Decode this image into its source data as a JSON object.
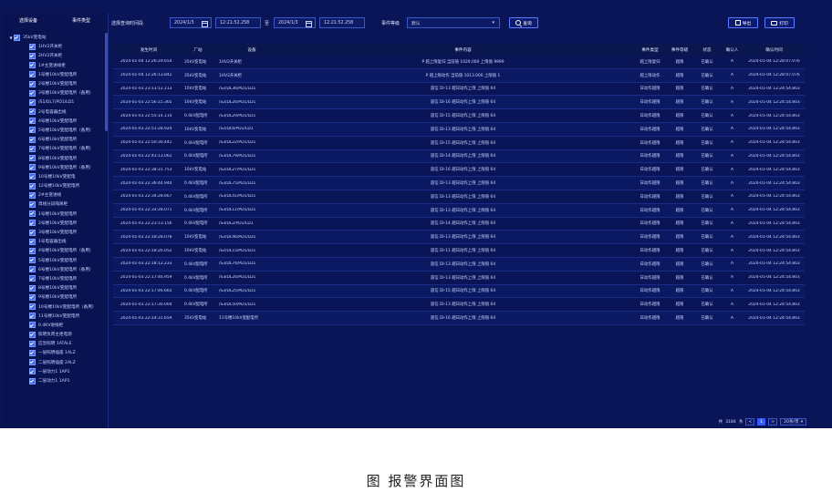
{
  "sidebar": {
    "tabs": [
      "选择设备",
      "事件类型"
    ],
    "tree": [
      {
        "label": "35kV变电站",
        "level": 0,
        "expanded": true
      },
      {
        "label": "1HV2开关柜",
        "level": 1
      },
      {
        "label": "2HV2开关柜",
        "level": 1
      },
      {
        "label": "1#主变进线柜",
        "level": 1
      },
      {
        "label": "1号楼10kV变配电所",
        "level": 1
      },
      {
        "label": "2号楼10kV变配电所",
        "level": 1
      },
      {
        "label": "3号楼10kV变配电所（备用）",
        "level": 1
      },
      {
        "label": "/S1/DL7/PD1/LD1",
        "level": 1
      },
      {
        "label": "2号电容器出线",
        "level": 1
      },
      {
        "label": "4号楼10kV变配电所",
        "level": 1
      },
      {
        "label": "5号楼10kV变配电所（备用）",
        "level": 1
      },
      {
        "label": "6号楼10kV变配电所",
        "level": 1
      },
      {
        "label": "7号楼10kV变配电所（备用）",
        "level": 1
      },
      {
        "label": "8号楼10kV变配电所",
        "level": 1
      },
      {
        "label": "9号楼10kV变配电所（备用）",
        "level": 1
      },
      {
        "label": "10号楼10kV变配电",
        "level": 1
      },
      {
        "label": "12号楼10kV变配电所",
        "level": 1
      },
      {
        "label": "2#主变进线",
        "level": 1
      },
      {
        "label": "母线分段隔离柜",
        "level": 1
      },
      {
        "label": "1号楼10kV变配电所",
        "level": 1
      },
      {
        "label": "2号楼10kV变配电所",
        "level": 1
      },
      {
        "label": "3号楼10kV变配电所",
        "level": 1
      },
      {
        "label": "1号电容器出线",
        "level": 1
      },
      {
        "label": "4号楼10kV变配电所（备用）",
        "level": 1
      },
      {
        "label": "5号楼10kV变配电所",
        "level": 1
      },
      {
        "label": "6号楼10kV变配电所（备用）",
        "level": 1
      },
      {
        "label": "7号楼10kV变配电所",
        "level": 1
      },
      {
        "label": "8号楼10kV变配电所",
        "level": 1
      },
      {
        "label": "9号楼10kV变配电所",
        "level": 1
      },
      {
        "label": "10号楼10kV变配电所（备用）",
        "level": 1
      },
      {
        "label": "11号楼10kV变配电所",
        "level": 1
      },
      {
        "label": "0.4KV进线柜",
        "level": 1
      },
      {
        "label": "照明负荷主柜电源",
        "level": 1
      },
      {
        "label": "应急照明 1ATALE",
        "level": 1
      },
      {
        "label": "一层照明插座 1ALZ",
        "level": 1
      },
      {
        "label": "二层照明插座 2ALZ",
        "level": 1
      },
      {
        "label": "一层动力1 1AP1",
        "level": 1
      },
      {
        "label": "二层动力1 1AP1",
        "level": 1
      }
    ]
  },
  "toolbar": {
    "time_label": "选择查询时间段",
    "start_date": "2024/1/3",
    "start_time": "12:21:52.258",
    "to_label": "至",
    "end_date": "2024/1/3",
    "end_time": "12:21:52.258",
    "level_label": "事件等级",
    "level_value": "默认",
    "search_label": "查询",
    "export_label": "导出",
    "print_label": "打印"
  },
  "table": {
    "columns": [
      "发生时间",
      "厂站",
      "设备",
      "事件内容",
      "事件类型",
      "事件等级",
      "状态",
      "确认人",
      "确认时间"
    ],
    "rows": [
      [
        "2024-01-04 12:26:29.654",
        "35kV变电站",
        "1HV2开关柜",
        "P 越上限复归 当前值 1029.000 上限值 9999",
        "越上限复归",
        "越限",
        "已确认",
        "A",
        "2024-01-04 12:28:07.076"
      ],
      [
        "2024-01-04 12:26:13.842",
        "35kV变电站",
        "1HV2开关柜",
        "P 越上限动作 当前值 1013.000 上限值 1",
        "越上限动作",
        "越限",
        "已确认",
        "A",
        "2024-01-04 12:28:07.076"
      ],
      [
        "2024-01-03 23:13:12.113",
        "10kV变电站",
        "/S2/DL36/PD1/LD1",
        "遥信 DI-13 越日动作上限 上限值 64",
        "日动作越限",
        "越限",
        "已确认",
        "A",
        "2024-01-04 12:24:54.803"
      ],
      [
        "2024-01-03 22:56:15.365",
        "10kV变电站",
        "/S2/DL26/PD1/LD1",
        "遥信 DI-16 越日动作上限 上限值 64",
        "日动作越限",
        "越限",
        "已确认",
        "A",
        "2024-01-04 12:24:54.803"
      ],
      [
        "2024-01-03 22:55:14.114",
        "0.4kV配电所",
        "/S3/DL29/PD1/LD1",
        "遥信 DI-15 越日动作上限 上限值 64",
        "日动作越限",
        "越限",
        "已确认",
        "A",
        "2024-01-04 12:24:54.803"
      ],
      [
        "2024-01-03 22:51:28.924",
        "10kV变电站",
        "/S2/DL6/PD1/LD1",
        "遥信 DI-13 越日动作上限 上限值 64",
        "日动作越限",
        "越限",
        "已确认",
        "A",
        "2024-01-04 12:24:54.803"
      ],
      [
        "2024-01-03 22:50:30.441",
        "0.4kV配电所",
        "/S3/DL22/PD1/LD1",
        "遥信 DI-15 越日动作上限 上限值 64",
        "日动作越限",
        "越限",
        "已确认",
        "A",
        "2024-01-04 12:24:54.803"
      ],
      [
        "2024-01-03 22:43:13.061",
        "0.4kV配电所",
        "/S3/DL79/PD1/LD1",
        "遥信 DI-14 越日动作上限 上限值 64",
        "日动作越限",
        "越限",
        "已确认",
        "A",
        "2024-01-04 12:24:54.803"
      ],
      [
        "2024-01-03 22:38:31.753",
        "10kV变电站",
        "/S2/DL27/PD1/LD1",
        "遥信 DI-16 越日动作上限 上限值 64",
        "日动作越限",
        "越限",
        "已确认",
        "A",
        "2024-01-04 12:24:54.803"
      ],
      [
        "2024-01-03 22:36:44.940",
        "0.4kV配电所",
        "/S3/DL75/PD1/LD1",
        "遥信 DI-13 越日动作上限 上限值 64",
        "日动作越限",
        "越限",
        "已确认",
        "A",
        "2024-01-04 12:24:54.803"
      ],
      [
        "2024-01-03 22:34:28.667",
        "0.4kV配电所",
        "/S3/DL41/PD1/LD1",
        "遥信 DI-13 越日动作上限 上限值 64",
        "日动作越限",
        "越限",
        "已确认",
        "A",
        "2024-01-04 12:24:54.803"
      ],
      [
        "2024-01-03 22:33:28.071",
        "0.4kV配电所",
        "/S3/DL11/PD1/LD1",
        "遥信 DI-13 越日动作上限 上限值 64",
        "日动作越限",
        "越限",
        "已确认",
        "A",
        "2024-01-04 12:24:54.803"
      ],
      [
        "2024-01-03 22:23:13.156",
        "0.4kV配电所",
        "/S3/DL2/PD1/LD1",
        "遥信 DI-14 越日动作上限 上限值 64",
        "日动作越限",
        "越限",
        "已确认",
        "A",
        "2024-01-04 12:24:54.803"
      ],
      [
        "2024-01-03 22:18:28.078",
        "10kV变电站",
        "/S2/DL46/PD1/LD1",
        "遥信 DI-13 越日动作上限 上限值 64",
        "日动作越限",
        "越限",
        "已确认",
        "A",
        "2024-01-04 12:24:54.803"
      ],
      [
        "2024-01-03 22:18:26.052",
        "10kV变电站",
        "/S2/DL15/PD1/LD1",
        "遥信 DI-11 越日动作上限 上限值 64",
        "日动作越限",
        "越限",
        "已确认",
        "A",
        "2024-01-04 12:24:54.803"
      ],
      [
        "2024-01-03 22:18:12.233",
        "0.4kV配电所",
        "/S3/DL74/PD1/LD1",
        "遥信 DI-13 越日动作上限 上限值 64",
        "日动作越限",
        "越限",
        "已确认",
        "A",
        "2024-01-04 12:24:54.803"
      ],
      [
        "2024-01-03 22:17:46.959",
        "0.4kV配电所",
        "/S3/DL26/PD1/LD1",
        "遥信 DI-13 越日动作上限 上限值 64",
        "日动作越限",
        "越限",
        "已确认",
        "A",
        "2024-01-04 12:24:54.803"
      ],
      [
        "2024-01-03 22:17:46.665",
        "0.4kV配电所",
        "/S3/DL25/PD1/LD1",
        "遥信 DI-15 越日动作上限 上限值 64",
        "日动作越限",
        "越限",
        "已确认",
        "A",
        "2024-01-04 12:24:54.803"
      ],
      [
        "2024-01-03 22:17:30.004",
        "0.4kV配电所",
        "/S3/DL50/PD1/LD1",
        "遥信 DI-13 越日动作上限 上限值 64",
        "日动作越限",
        "越限",
        "已确认",
        "A",
        "2024-01-04 12:24:54.803"
      ],
      [
        "2024-01-03 22:14:31.659",
        "35kV变电站",
        "11号楼10kV变配电所",
        "遥信 DI-16 越日动作上限 上限值 64",
        "日动作越限",
        "越限",
        "已确认",
        "A",
        "2024-01-04 12:24:54.803"
      ]
    ]
  },
  "pager": {
    "total_prefix": "共",
    "total": "3184",
    "total_suffix": "条",
    "prev": "<",
    "current": "1",
    "next": ">",
    "page_size": "20条/页"
  },
  "caption": "图 报警界面图",
  "colors": {
    "background": "#0a1557",
    "accent": "#2f5bff",
    "checkbox": "#3f69e6"
  }
}
